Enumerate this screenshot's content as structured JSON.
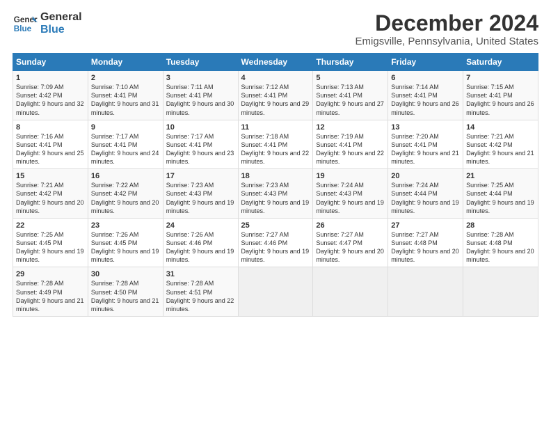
{
  "logo": {
    "line1": "General",
    "line2": "Blue"
  },
  "title": "December 2024",
  "subtitle": "Emigsville, Pennsylvania, United States",
  "header": {
    "days": [
      "Sunday",
      "Monday",
      "Tuesday",
      "Wednesday",
      "Thursday",
      "Friday",
      "Saturday"
    ]
  },
  "weeks": [
    [
      {
        "day": "1",
        "rise": "Sunrise: 7:09 AM",
        "set": "Sunset: 4:42 PM",
        "daylight": "Daylight: 9 hours and 32 minutes."
      },
      {
        "day": "2",
        "rise": "Sunrise: 7:10 AM",
        "set": "Sunset: 4:41 PM",
        "daylight": "Daylight: 9 hours and 31 minutes."
      },
      {
        "day": "3",
        "rise": "Sunrise: 7:11 AM",
        "set": "Sunset: 4:41 PM",
        "daylight": "Daylight: 9 hours and 30 minutes."
      },
      {
        "day": "4",
        "rise": "Sunrise: 7:12 AM",
        "set": "Sunset: 4:41 PM",
        "daylight": "Daylight: 9 hours and 29 minutes."
      },
      {
        "day": "5",
        "rise": "Sunrise: 7:13 AM",
        "set": "Sunset: 4:41 PM",
        "daylight": "Daylight: 9 hours and 27 minutes."
      },
      {
        "day": "6",
        "rise": "Sunrise: 7:14 AM",
        "set": "Sunset: 4:41 PM",
        "daylight": "Daylight: 9 hours and 26 minutes."
      },
      {
        "day": "7",
        "rise": "Sunrise: 7:15 AM",
        "set": "Sunset: 4:41 PM",
        "daylight": "Daylight: 9 hours and 26 minutes."
      }
    ],
    [
      {
        "day": "8",
        "rise": "Sunrise: 7:16 AM",
        "set": "Sunset: 4:41 PM",
        "daylight": "Daylight: 9 hours and 25 minutes."
      },
      {
        "day": "9",
        "rise": "Sunrise: 7:17 AM",
        "set": "Sunset: 4:41 PM",
        "daylight": "Daylight: 9 hours and 24 minutes."
      },
      {
        "day": "10",
        "rise": "Sunrise: 7:17 AM",
        "set": "Sunset: 4:41 PM",
        "daylight": "Daylight: 9 hours and 23 minutes."
      },
      {
        "day": "11",
        "rise": "Sunrise: 7:18 AM",
        "set": "Sunset: 4:41 PM",
        "daylight": "Daylight: 9 hours and 22 minutes."
      },
      {
        "day": "12",
        "rise": "Sunrise: 7:19 AM",
        "set": "Sunset: 4:41 PM",
        "daylight": "Daylight: 9 hours and 22 minutes."
      },
      {
        "day": "13",
        "rise": "Sunrise: 7:20 AM",
        "set": "Sunset: 4:41 PM",
        "daylight": "Daylight: 9 hours and 21 minutes."
      },
      {
        "day": "14",
        "rise": "Sunrise: 7:21 AM",
        "set": "Sunset: 4:42 PM",
        "daylight": "Daylight: 9 hours and 21 minutes."
      }
    ],
    [
      {
        "day": "15",
        "rise": "Sunrise: 7:21 AM",
        "set": "Sunset: 4:42 PM",
        "daylight": "Daylight: 9 hours and 20 minutes."
      },
      {
        "day": "16",
        "rise": "Sunrise: 7:22 AM",
        "set": "Sunset: 4:42 PM",
        "daylight": "Daylight: 9 hours and 20 minutes."
      },
      {
        "day": "17",
        "rise": "Sunrise: 7:23 AM",
        "set": "Sunset: 4:43 PM",
        "daylight": "Daylight: 9 hours and 19 minutes."
      },
      {
        "day": "18",
        "rise": "Sunrise: 7:23 AM",
        "set": "Sunset: 4:43 PM",
        "daylight": "Daylight: 9 hours and 19 minutes."
      },
      {
        "day": "19",
        "rise": "Sunrise: 7:24 AM",
        "set": "Sunset: 4:43 PM",
        "daylight": "Daylight: 9 hours and 19 minutes."
      },
      {
        "day": "20",
        "rise": "Sunrise: 7:24 AM",
        "set": "Sunset: 4:44 PM",
        "daylight": "Daylight: 9 hours and 19 minutes."
      },
      {
        "day": "21",
        "rise": "Sunrise: 7:25 AM",
        "set": "Sunset: 4:44 PM",
        "daylight": "Daylight: 9 hours and 19 minutes."
      }
    ],
    [
      {
        "day": "22",
        "rise": "Sunrise: 7:25 AM",
        "set": "Sunset: 4:45 PM",
        "daylight": "Daylight: 9 hours and 19 minutes."
      },
      {
        "day": "23",
        "rise": "Sunrise: 7:26 AM",
        "set": "Sunset: 4:45 PM",
        "daylight": "Daylight: 9 hours and 19 minutes."
      },
      {
        "day": "24",
        "rise": "Sunrise: 7:26 AM",
        "set": "Sunset: 4:46 PM",
        "daylight": "Daylight: 9 hours and 19 minutes."
      },
      {
        "day": "25",
        "rise": "Sunrise: 7:27 AM",
        "set": "Sunset: 4:46 PM",
        "daylight": "Daylight: 9 hours and 19 minutes."
      },
      {
        "day": "26",
        "rise": "Sunrise: 7:27 AM",
        "set": "Sunset: 4:47 PM",
        "daylight": "Daylight: 9 hours and 20 minutes."
      },
      {
        "day": "27",
        "rise": "Sunrise: 7:27 AM",
        "set": "Sunset: 4:48 PM",
        "daylight": "Daylight: 9 hours and 20 minutes."
      },
      {
        "day": "28",
        "rise": "Sunrise: 7:28 AM",
        "set": "Sunset: 4:48 PM",
        "daylight": "Daylight: 9 hours and 20 minutes."
      }
    ],
    [
      {
        "day": "29",
        "rise": "Sunrise: 7:28 AM",
        "set": "Sunset: 4:49 PM",
        "daylight": "Daylight: 9 hours and 21 minutes."
      },
      {
        "day": "30",
        "rise": "Sunrise: 7:28 AM",
        "set": "Sunset: 4:50 PM",
        "daylight": "Daylight: 9 hours and 21 minutes."
      },
      {
        "day": "31",
        "rise": "Sunrise: 7:28 AM",
        "set": "Sunset: 4:51 PM",
        "daylight": "Daylight: 9 hours and 22 minutes."
      },
      null,
      null,
      null,
      null
    ]
  ]
}
